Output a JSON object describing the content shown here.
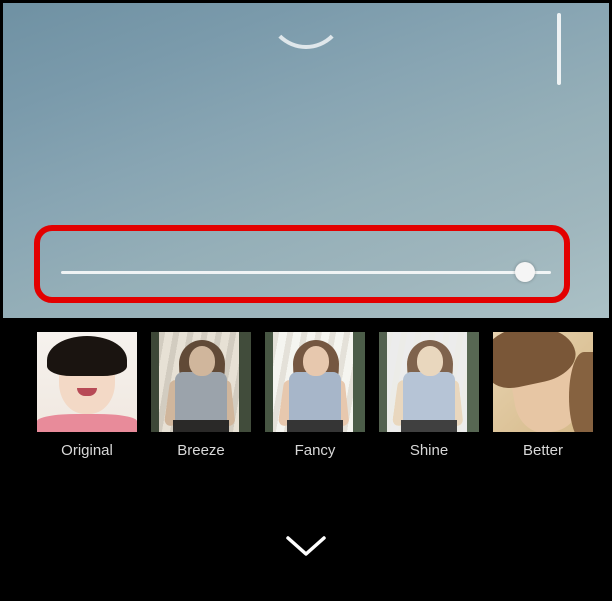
{
  "slider": {
    "value_percent": 96
  },
  "highlight": {
    "target": "intensity-slider",
    "color": "#e30000"
  },
  "filters": [
    {
      "id": "original",
      "label": "Original"
    },
    {
      "id": "breeze",
      "label": "Breeze"
    },
    {
      "id": "fancy",
      "label": "Fancy"
    },
    {
      "id": "shine",
      "label": "Shine"
    },
    {
      "id": "better",
      "label": "Better"
    }
  ],
  "controls": {
    "collapse_icon": "chevron-down"
  }
}
